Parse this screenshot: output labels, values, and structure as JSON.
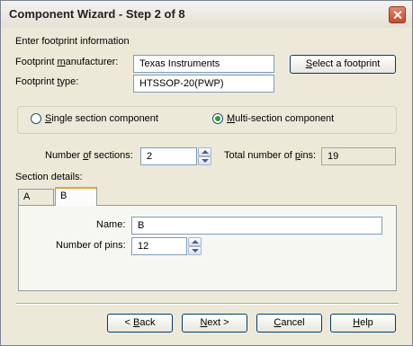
{
  "window": {
    "title": "Component Wizard - Step 2 of 8"
  },
  "footprint": {
    "heading": "Enter footprint information",
    "manufacturer_label_pre": "Footprint ",
    "manufacturer_label_ul": "m",
    "manufacturer_label_post": "anufacturer:",
    "manufacturer_value": "Texas Instruments",
    "type_label_pre": "Footprint ",
    "type_label_ul": "t",
    "type_label_post": "ype:",
    "type_value": "HTSSOP-20(PWP)",
    "select_button_pre": "",
    "select_button_ul": "S",
    "select_button_post": "elect a footprint"
  },
  "section_type": {
    "single_pre": "",
    "single_ul": "S",
    "single_post": "ingle section component",
    "multi_pre": "",
    "multi_ul": "M",
    "multi_post": "ulti-section component",
    "selected": "multi"
  },
  "sections": {
    "number_label_pre": "Number ",
    "number_label_ul": "o",
    "number_label_post": "f sections:",
    "number_value": "2",
    "total_pins_label_pre": "Total number of ",
    "total_pins_label_ul": "p",
    "total_pins_label_post": "ins:",
    "total_pins_value": "19"
  },
  "section_details": {
    "heading": "Section details:",
    "tabs": [
      {
        "label": "A"
      },
      {
        "label": "B"
      }
    ],
    "active_tab": "B",
    "name_label": "Name:",
    "name_value": "B",
    "pins_label": "Number of pins:",
    "pins_value": "12"
  },
  "buttons": {
    "back_pre": "< ",
    "back_ul": "B",
    "back_post": "ack",
    "next_pre": "",
    "next_ul": "N",
    "next_post": "ext >",
    "cancel_pre": "",
    "cancel_ul": "C",
    "cancel_post": "ancel",
    "help_pre": "",
    "help_ul": "H",
    "help_post": "elp"
  }
}
